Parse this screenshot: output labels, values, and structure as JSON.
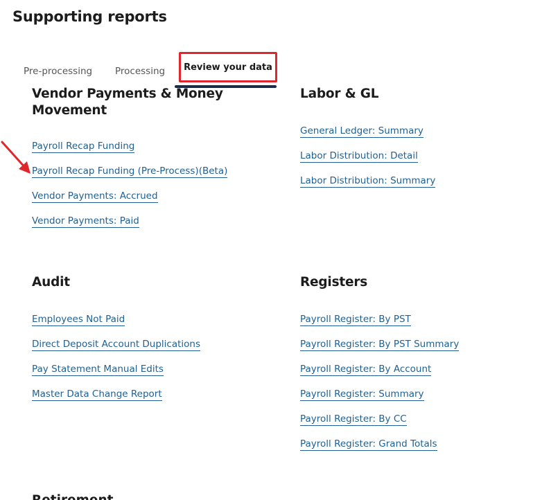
{
  "page": {
    "title": "Supporting reports"
  },
  "tabs": [
    {
      "label": "Pre-processing"
    },
    {
      "label": "Processing"
    },
    {
      "label": "Review your data",
      "active": true
    }
  ],
  "sections": {
    "vendor": {
      "title": "Vendor Payments & Money Movement",
      "links": [
        "Payroll Recap Funding",
        "Payroll Recap Funding (Pre-Process)(Beta)",
        "Vendor Payments: Accrued",
        "Vendor Payments: Paid"
      ]
    },
    "labor": {
      "title": "Labor & GL",
      "links": [
        "General Ledger: Summary",
        "Labor Distribution: Detail",
        "Labor Distribution: Summary"
      ]
    },
    "audit": {
      "title": "Audit",
      "links": [
        "Employees Not Paid",
        "Direct Deposit Account Duplications",
        "Pay Statement Manual Edits",
        "Master Data Change Report"
      ]
    },
    "registers": {
      "title": "Registers",
      "links": [
        "Payroll Register: By PST",
        "Payroll Register: By PST Summary",
        "Payroll Register: By Account",
        "Payroll Register: Summary",
        "Payroll Register: By CC",
        "Payroll Register: Grand Totals"
      ]
    },
    "retirement": {
      "title": "Retirement"
    }
  },
  "colors": {
    "link": "#1f5f93",
    "highlight_box": "#e0262b",
    "active_tab_underline": "#1c2b4a",
    "annotation_arrow": "#e0262b"
  },
  "icons": {
    "annotation": "red-arrow-icon"
  }
}
